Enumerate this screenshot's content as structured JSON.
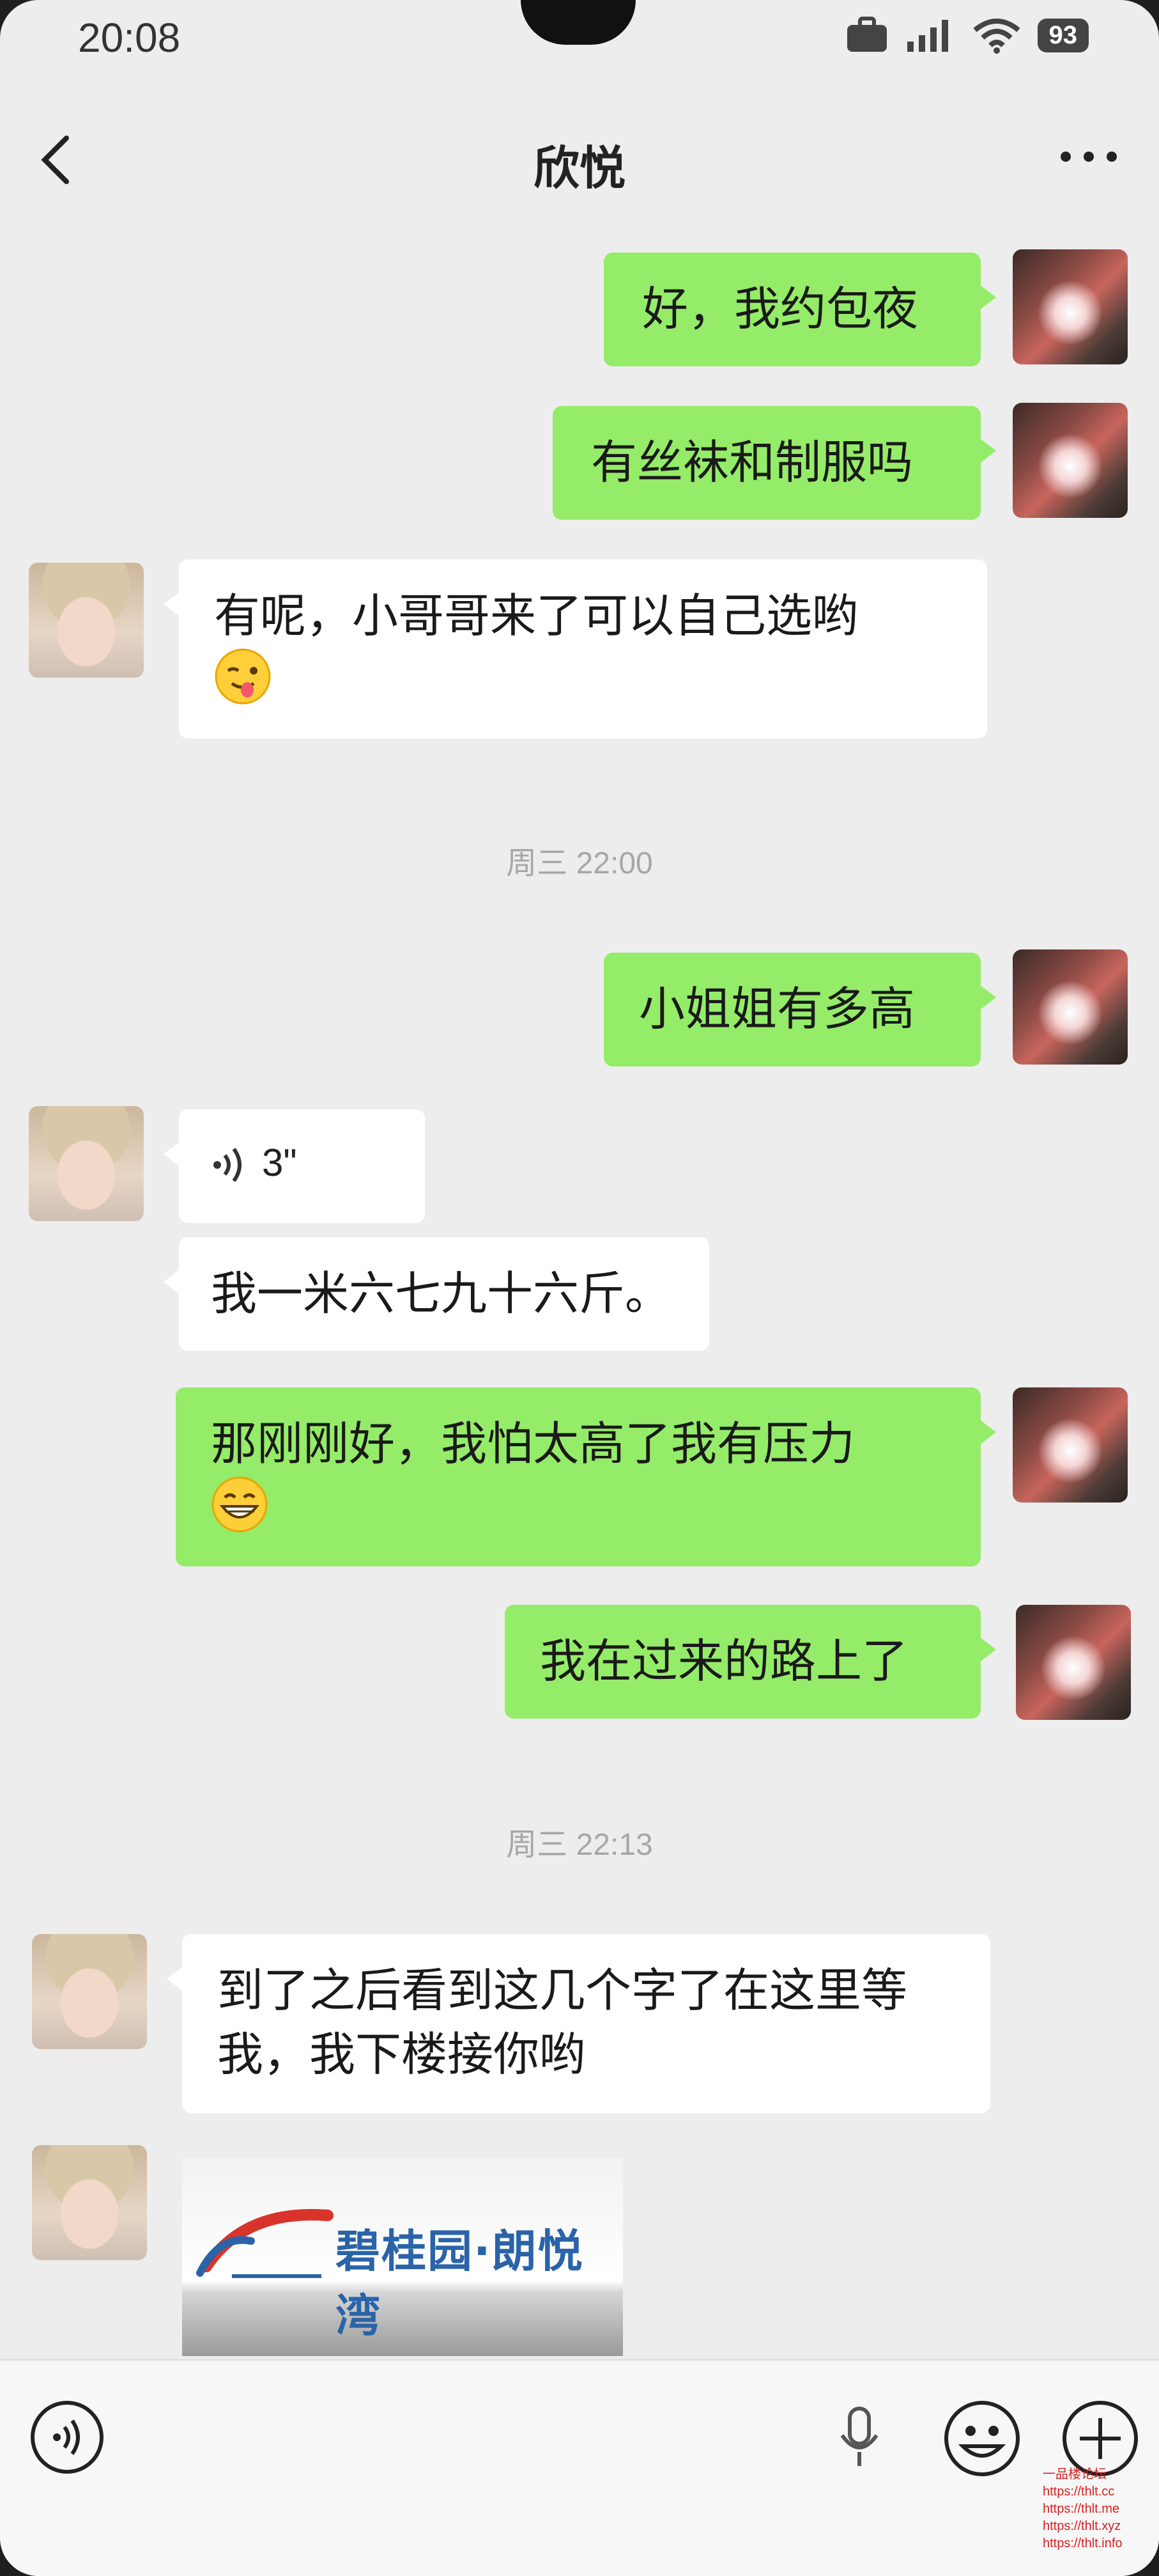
{
  "status_bar": {
    "time": "20:08",
    "battery": "93"
  },
  "header": {
    "title": "欣悦"
  },
  "messages": [
    {
      "side": "me",
      "text": "好，我约包夜"
    },
    {
      "side": "me",
      "text": "有丝袜和制服吗"
    },
    {
      "side": "her",
      "text_line1": "有呢，小哥哥来了可以自己选哟"
    },
    {
      "side": "me",
      "text": "小姐姐有多高"
    },
    {
      "side": "her",
      "voice_length": "3\""
    },
    {
      "side": "her",
      "text": "我一米六七九十六斤。"
    },
    {
      "side": "me",
      "text_line1": "那刚刚好，我怕太高了我有压力"
    },
    {
      "side": "me",
      "text": "我在过来的路上了"
    },
    {
      "side": "her",
      "text_line1": "到了之后看到这几个字了在这里等",
      "text_line2": "我，我下楼接你哟"
    }
  ],
  "timestamps": [
    "周三 22:00",
    "周三 22:13"
  ],
  "image_message": {
    "caption_text": "碧桂园·朗悦湾"
  },
  "input_bar": {
    "icons": [
      "voice-input-icon",
      "microphone-icon",
      "emoji-icon",
      "plus-icon"
    ]
  },
  "watermark": {
    "lines": [
      "一品楼论坛",
      "https://thlt.cc",
      "https://thlt.me",
      "https://thlt.xyz",
      "https://thlt.info"
    ]
  }
}
